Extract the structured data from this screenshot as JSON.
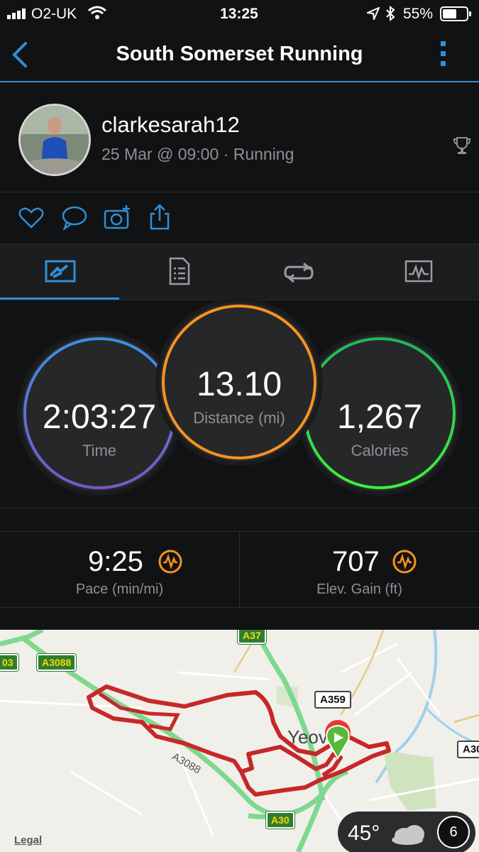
{
  "status_bar": {
    "carrier": "O2-UK",
    "time": "13:25",
    "battery": "55%",
    "icons": [
      "signal-icon",
      "wifi-icon",
      "location-icon",
      "bluetooth-icon",
      "battery-icon"
    ]
  },
  "nav": {
    "title": "South Somerset Running",
    "back_icon": "back-chevron-icon",
    "menu_icon": "more-vertical-icon",
    "accent": "#2f8fd6"
  },
  "profile": {
    "username": "clarkesarah12",
    "meta": "25 Mar @ 09:00 · Running",
    "badge_icon": "trophy-icon"
  },
  "actions": [
    "heart-icon",
    "comment-icon",
    "add-photo-icon",
    "share-icon"
  ],
  "tabs": [
    "overview-tab",
    "details-tab",
    "laps-tab",
    "charts-tab"
  ],
  "metrics": {
    "time": {
      "value": "2:03:27",
      "label": "Time"
    },
    "distance": {
      "value": "13.10",
      "label": "Distance (mi)"
    },
    "calories": {
      "value": "1,267",
      "label": "Calories"
    },
    "colors": {
      "time": "#4a8fe0",
      "distance": "#f7931e",
      "calories": "#2ad04a"
    }
  },
  "stats": {
    "pace": {
      "value": "9:25",
      "label": "Pace (min/mi)"
    },
    "elevation": {
      "value": "707",
      "label": "Elev. Gain (ft)"
    },
    "icon_color": "#f7931e"
  },
  "map": {
    "roads": [
      "A3088",
      "A37",
      "A359",
      "A30",
      "A3088",
      "A30",
      "03",
      "A30"
    ],
    "town": "Yeov",
    "legal": "Legal",
    "weather": {
      "temp": "45°",
      "count": "6"
    },
    "route_color": "#c62828"
  }
}
